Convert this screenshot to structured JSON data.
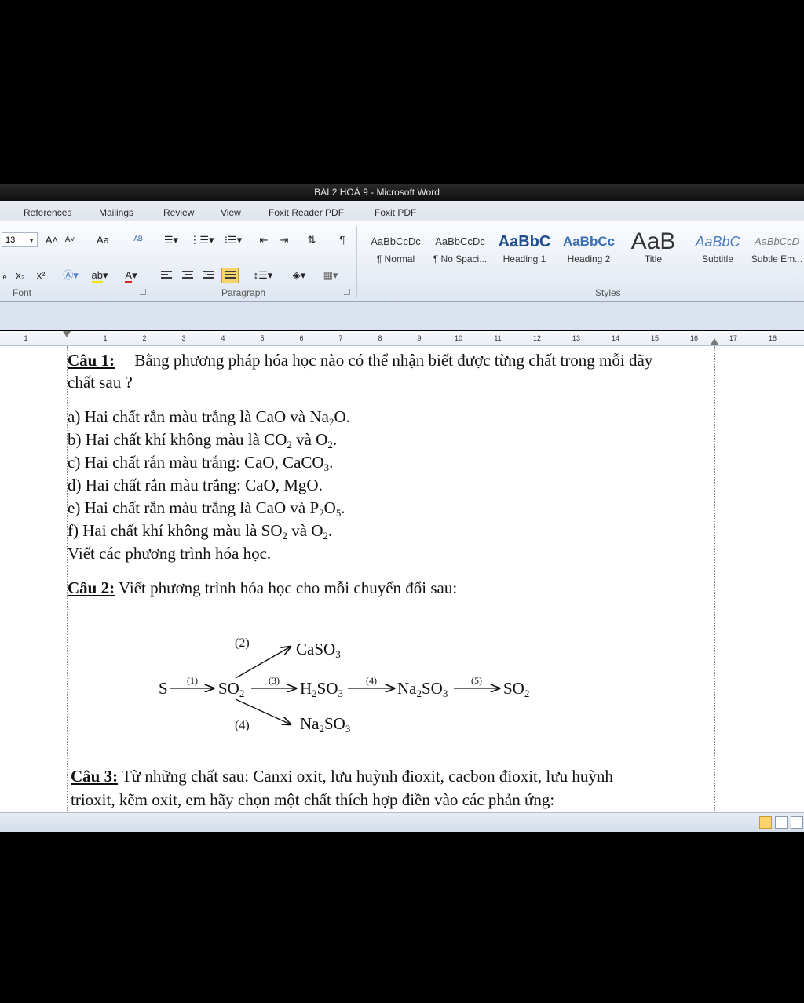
{
  "window": {
    "title": "BÀI 2 HOÁ 9 - Microsoft Word"
  },
  "ribbon_tabs": [
    "References",
    "Mailings",
    "Review",
    "View",
    "Foxit Reader PDF",
    "Foxit PDF"
  ],
  "font_group": {
    "label": "Font",
    "font_size": "13",
    "grow_font": "A˄",
    "shrink_font": "A˅",
    "change_case": "Aa",
    "subscript": "x₂",
    "superscript": "x²"
  },
  "paragraph_group": {
    "label": "Paragraph",
    "pilcrow": "¶"
  },
  "styles_group": {
    "label": "Styles",
    "items": [
      {
        "sample": "AaBbCcDc",
        "name": "¶ Normal"
      },
      {
        "sample": "AaBbCcDc",
        "name": "¶ No Spaci..."
      },
      {
        "sample": "AaBbC",
        "name": "Heading 1"
      },
      {
        "sample": "AaBbCc",
        "name": "Heading 2"
      },
      {
        "sample": "AaB",
        "name": "Title"
      },
      {
        "sample": "AaBbC",
        "name": "Subtitle"
      },
      {
        "sample": "AaBbCcD",
        "name": "Subtle Em..."
      }
    ]
  },
  "ruler": {
    "numbers": [
      "1",
      "1",
      "2",
      "3",
      "4",
      "5",
      "6",
      "7",
      "8",
      "9",
      "10",
      "11",
      "12",
      "13",
      "14",
      "15",
      "16",
      "17",
      "18"
    ]
  },
  "document": {
    "q1": {
      "label": "Câu 1:",
      "text_line1": "Bằng phương pháp hóa học nào có thể nhận biết được từng chất trong mỗi dãy",
      "text_line2": "chất sau ?",
      "a": {
        "pre": "a) Hai chất rắn màu trắng là CaO và Na",
        "s1": "2",
        "post": "O."
      },
      "b": {
        "pre": "b) Hai chất khí không màu là CO",
        "s1": "2",
        "mid": " và O",
        "s2": "2",
        "post": "."
      },
      "c": {
        "pre": "c) Hai chất rắn màu trắng: CaO, CaCO",
        "s1": "3",
        "post": "."
      },
      "d": "d) Hai chất rắn màu trắng: CaO, MgO.",
      "e": {
        "pre": "e) Hai chất rắn màu trắng là CaO và P",
        "s1": "2",
        "mid": "O",
        "s2": "5",
        "post": "."
      },
      "f": {
        "pre": "f) Hai chất khí không màu là SO",
        "s1": "2",
        "mid": " và O",
        "s2": "2",
        "post": "."
      },
      "closing": "Viết các phương trình hóa học."
    },
    "q2": {
      "label": "Câu 2:",
      "text": "Viết phương trình hóa học cho mỗi chuyển đổi sau:",
      "diagram": {
        "S": "S",
        "SO2_base": "SO",
        "SO2_sub": "2",
        "H2SO3_a": "H",
        "H2SO3_s1": "2",
        "H2SO3_b": "SO",
        "H2SO3_s2": "3",
        "Na2SO3_a": "Na",
        "Na2SO3_s1": "2",
        "Na2SO3_b": "SO",
        "Na2SO3_s2": "3",
        "SO2b_base": "SO",
        "SO2b_sub": "2",
        "CaSO3_base": "CaSO",
        "CaSO3_sub": "3",
        "Na2SO3d_a": "Na",
        "Na2SO3d_s1": "2",
        "Na2SO3d_b": "SO",
        "Na2SO3d_s2": "3",
        "step1": "(1)",
        "step2": "(2)",
        "step3": "(3)",
        "step4a": "(4)",
        "step4b": "(4)",
        "step5": "(5)"
      }
    },
    "q3": {
      "label": "Câu 3:",
      "text_line1": "Từ những chất sau: Canxi oxit, lưu huỳnh đioxit, cacbon đioxit, lưu huỳnh",
      "text_line2": "trioxit, kẽm oxit, em hãy chọn một chất thích hợp điền vào các phản ứng:"
    }
  }
}
